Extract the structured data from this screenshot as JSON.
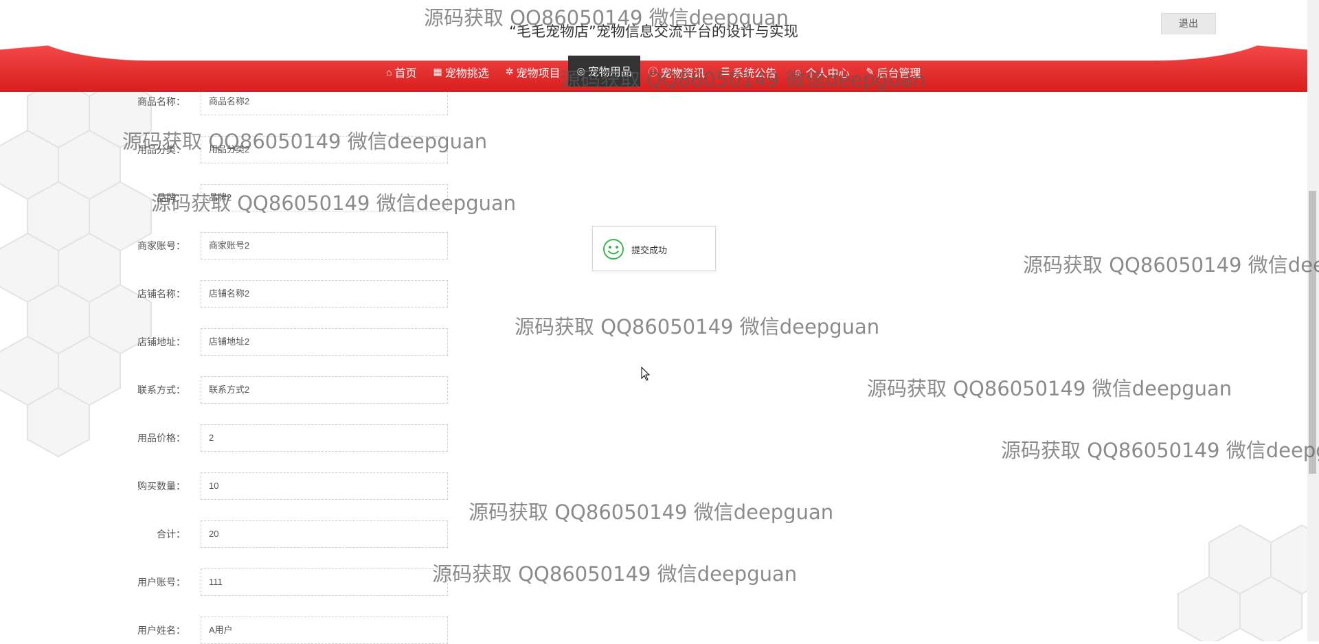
{
  "header": {
    "site_title": "“毛毛宠物店”宠物信息交流平台的设计与实现",
    "logout_label": "退出"
  },
  "nav": {
    "items": [
      {
        "label": "首页",
        "icon": "home-icon"
      },
      {
        "label": "宠物挑选",
        "icon": "grid-icon"
      },
      {
        "label": "宠物项目",
        "icon": "gear-icon"
      },
      {
        "label": "宠物用品",
        "icon": "globe-icon",
        "active": true
      },
      {
        "label": "宠物资讯",
        "icon": "info-icon"
      },
      {
        "label": "系统公告",
        "icon": "list-icon"
      },
      {
        "label": "个人中心",
        "icon": "user-icon"
      },
      {
        "label": "后台管理",
        "icon": "wrench-icon"
      }
    ]
  },
  "form": {
    "fields": [
      {
        "label": "商品名称：",
        "value": "商品名称2"
      },
      {
        "label": "用品分类：",
        "value": "用品分类2"
      },
      {
        "label": "品牌：",
        "value": "品牌2"
      },
      {
        "label": "商家账号：",
        "value": "商家账号2"
      },
      {
        "label": "店铺名称：",
        "value": "店铺名称2"
      },
      {
        "label": "店铺地址：",
        "value": "店铺地址2"
      },
      {
        "label": "联系方式：",
        "value": "联系方式2"
      },
      {
        "label": "用品价格：",
        "value": "2"
      },
      {
        "label": "购买数量：",
        "value": "10"
      },
      {
        "label": "合计：",
        "value": "20"
      },
      {
        "label": "用户账号：",
        "value": "111"
      },
      {
        "label": "用户姓名：",
        "value": "A用户"
      }
    ]
  },
  "toast": {
    "message": "提交成功",
    "icon": "smile-icon"
  },
  "watermark": {
    "text": "源码获取 QQ86050149 微信deepguan"
  },
  "colors": {
    "nav_red": "#e62c2c",
    "nav_active": "#333333",
    "toast_icon": "#39b54a"
  }
}
